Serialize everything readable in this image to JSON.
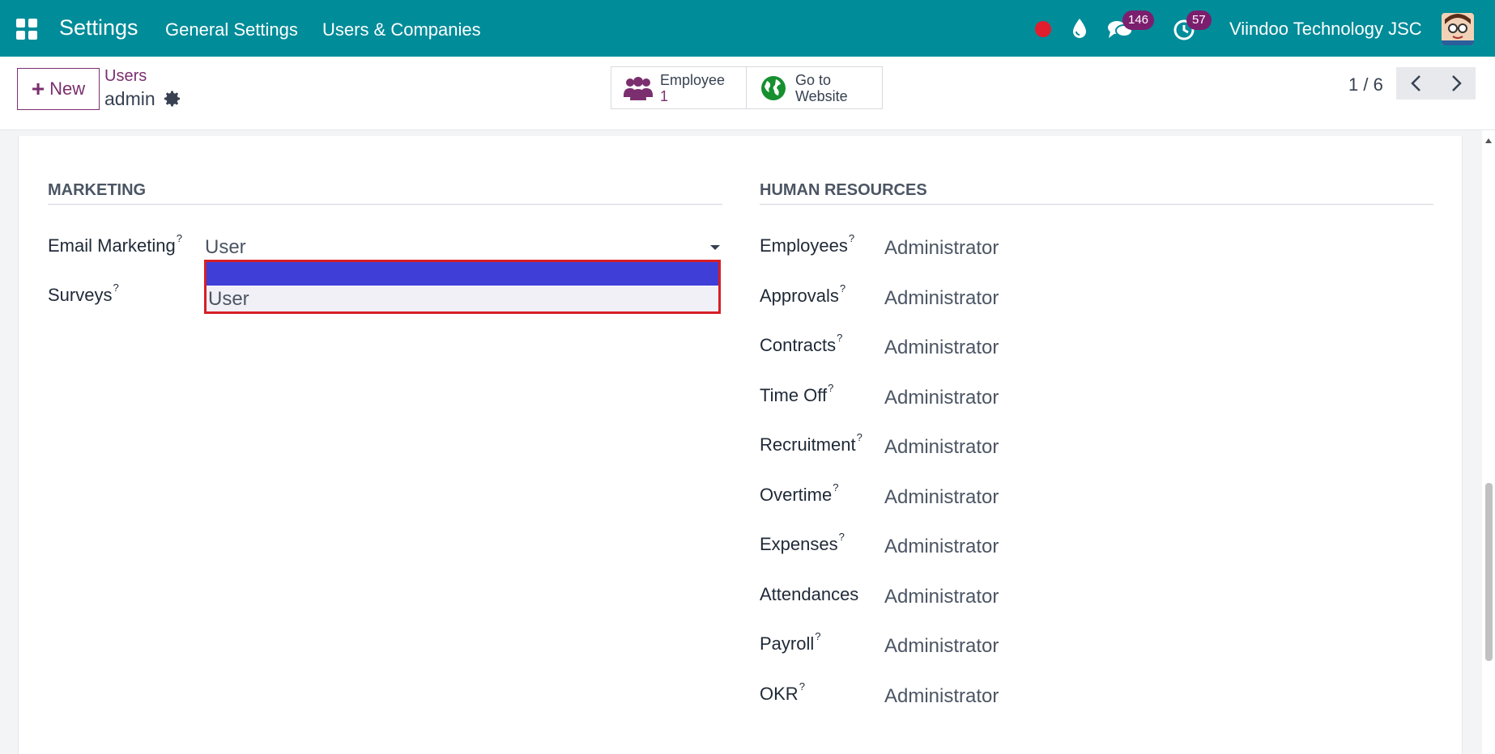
{
  "navbar": {
    "brand": "Settings",
    "menu": [
      "General Settings",
      "Users & Companies"
    ],
    "chat_badge": "146",
    "activity_badge": "57",
    "company": "Viindoo Technology JSC",
    "colors": {
      "bar": "#018c99",
      "badge": "#7b1e6e",
      "record": "#e11d2e"
    },
    "icons": [
      "apps-grid-icon",
      "record-dot-icon",
      "water-drop-icon",
      "chat-icon",
      "clock-icon",
      "avatar"
    ]
  },
  "control_panel": {
    "new_label": "New",
    "breadcrumb_parent": "Users",
    "breadcrumb_current": "admin",
    "smart_buttons": [
      {
        "line1": "Employee",
        "line2": "1",
        "icon": "users-icon"
      },
      {
        "line1": "Go to",
        "line2": "Website",
        "icon": "globe-icon"
      }
    ],
    "pager": "1 / 6"
  },
  "marketing": {
    "title": "MARKETING",
    "fields": [
      {
        "label": "Email Marketing",
        "help": "?",
        "value": "User"
      },
      {
        "label": "Surveys",
        "help": "?",
        "value": ""
      }
    ],
    "dropdown_options": [
      "",
      "User"
    ]
  },
  "hr": {
    "title": "HUMAN RESOURCES",
    "fields": [
      {
        "label": "Employees",
        "help": "?",
        "value": "Administrator"
      },
      {
        "label": "Approvals",
        "help": "?",
        "value": "Administrator"
      },
      {
        "label": "Contracts",
        "help": "?",
        "value": "Administrator"
      },
      {
        "label": "Time Off",
        "help": "?",
        "value": "Administrator"
      },
      {
        "label": "Recruitment",
        "help": "?",
        "value": "Administrator"
      },
      {
        "label": "Overtime",
        "help": "?",
        "value": "Administrator"
      },
      {
        "label": "Expenses",
        "help": "?",
        "value": "Administrator"
      },
      {
        "label": "Attendances",
        "help": "",
        "value": "Administrator"
      },
      {
        "label": "Payroll",
        "help": "?",
        "value": "Administrator"
      },
      {
        "label": "OKR",
        "help": "?",
        "value": "Administrator"
      }
    ]
  }
}
